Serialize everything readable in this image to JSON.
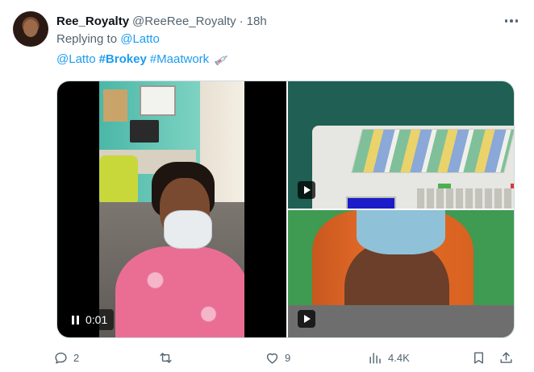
{
  "tweet": {
    "display_name": "Ree_Royalty",
    "handle": "@ReeRee_Royalty",
    "separator": "·",
    "time": "18h",
    "replying_prefix": "Replying to",
    "replying_to": "@Latto",
    "text": {
      "mention": "@Latto",
      "hashtag_bold": "#Brokey",
      "hashtag": "#Maatwork",
      "emoji_icon": "syringe-icon"
    },
    "media": {
      "video_time": "0:01"
    },
    "actions": {
      "replies": "2",
      "retweets": "",
      "likes": "9",
      "views": "4.4K"
    }
  },
  "colors": {
    "link": "#1d9bf0",
    "secondary_text": "#536471",
    "primary_text": "#0f1419"
  }
}
